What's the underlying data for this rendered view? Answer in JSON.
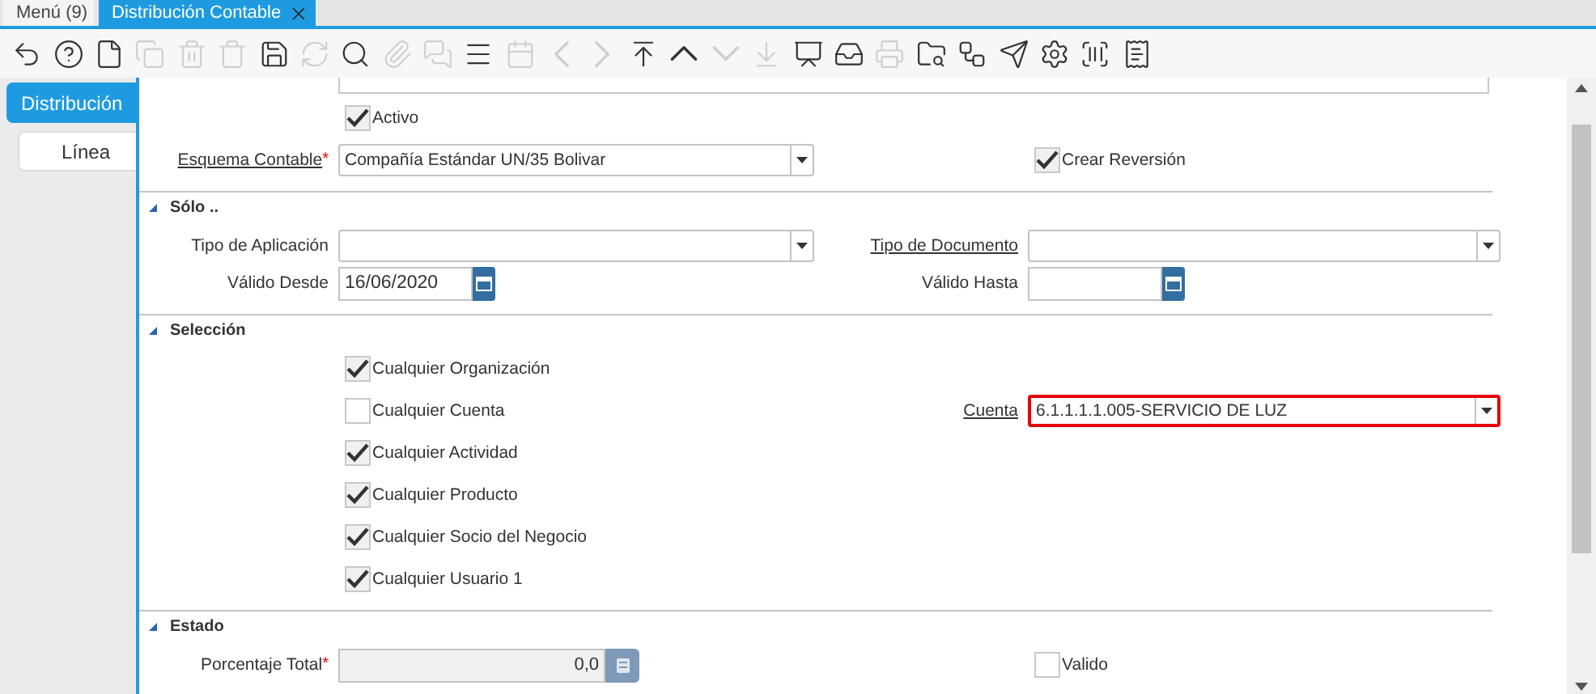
{
  "tabs": [
    {
      "label": "Menú (9)",
      "selected": false,
      "closable": false
    },
    {
      "label": "Distribución Contable",
      "selected": true,
      "closable": true
    }
  ],
  "toolbar": [
    {
      "kind": "undo",
      "disabled": false
    },
    {
      "kind": "help",
      "disabled": false
    },
    {
      "kind": "new",
      "disabled": false
    },
    {
      "kind": "copy",
      "disabled": true
    },
    {
      "kind": "delete",
      "disabled": true
    },
    {
      "kind": "deletemany",
      "disabled": true
    },
    {
      "kind": "save",
      "disabled": false
    },
    {
      "kind": "refresh",
      "disabled": true
    },
    {
      "kind": "search",
      "disabled": false
    },
    {
      "kind": "attach",
      "disabled": true
    },
    {
      "kind": "chat",
      "disabled": true
    },
    {
      "kind": "grid",
      "disabled": false
    },
    {
      "kind": "calendar",
      "disabled": true
    },
    {
      "kind": "previous",
      "disabled": true
    },
    {
      "kind": "next",
      "disabled": true
    },
    {
      "kind": "first",
      "disabled": false
    },
    {
      "kind": "up",
      "disabled": false
    },
    {
      "kind": "down",
      "disabled": true
    },
    {
      "kind": "last",
      "disabled": true
    },
    {
      "kind": "report",
      "disabled": false
    },
    {
      "kind": "archive",
      "disabled": false
    },
    {
      "kind": "print",
      "disabled": true
    },
    {
      "kind": "zoom",
      "disabled": false
    },
    {
      "kind": "workflow",
      "disabled": false
    },
    {
      "kind": "send",
      "disabled": false
    },
    {
      "kind": "settings",
      "disabled": false
    },
    {
      "kind": "scan",
      "disabled": false
    },
    {
      "kind": "receipt",
      "disabled": false
    }
  ],
  "side_tabs": [
    {
      "label": "Distribución",
      "selected": true
    },
    {
      "label": "Línea",
      "selected": false
    }
  ],
  "sections": [
    {
      "rows": [
        {
          "left": {
            "kind": "checkbox",
            "label": "Activo",
            "checked": true
          }
        },
        {
          "left": {
            "kind": "select",
            "label": "Esquema Contable",
            "link": true,
            "required_mark": "*",
            "value": "Compañía Estándar UN/35 Bolivar"
          },
          "right": {
            "kind": "checkbox",
            "label": "Crear Reversión",
            "checked": true
          }
        }
      ]
    },
    {
      "title": "Sólo ..",
      "expanded": true,
      "rows": [
        {
          "left": {
            "kind": "select",
            "label": "Tipo de Aplicación",
            "link": false
          },
          "right": {
            "kind": "select",
            "label": "Tipo de Documento",
            "link": true
          }
        },
        {
          "left": {
            "kind": "date",
            "label": "Válido Desde",
            "link": false,
            "value": "16/06/2020"
          },
          "right": {
            "kind": "date",
            "label": "Válido Hasta",
            "link": false
          }
        }
      ]
    },
    {
      "title": "Selección",
      "expanded": true,
      "rows": [
        {
          "left": {
            "kind": "checkbox",
            "label": "Cualquier Organización",
            "checked": true
          }
        },
        {
          "left": {
            "kind": "checkbox",
            "label": "Cualquier Cuenta",
            "checked": false
          },
          "right": {
            "kind": "select",
            "label": "Cuenta",
            "link": true,
            "highlighted": true,
            "value": "6.1.1.1.1.005-SERVICIO DE LUZ"
          }
        },
        {
          "left": {
            "kind": "checkbox",
            "label": "Cualquier Actividad",
            "checked": true
          }
        },
        {
          "left": {
            "kind": "checkbox",
            "label": "Cualquier Producto",
            "checked": true
          }
        },
        {
          "left": {
            "kind": "checkbox",
            "label": "Cualquier Socio del Negocio",
            "checked": true
          }
        },
        {
          "left": {
            "kind": "checkbox",
            "label": "Cualquier Usuario 1",
            "checked": true
          }
        }
      ]
    },
    {
      "title": "Estado",
      "expanded": true,
      "rows": [
        {
          "left": {
            "kind": "number",
            "label": "Porcentaje Total",
            "link": false,
            "required_mark": "*",
            "value": "0,0"
          },
          "right": {
            "kind": "checkbox",
            "label": "Valido",
            "checked": false
          }
        }
      ]
    }
  ]
}
